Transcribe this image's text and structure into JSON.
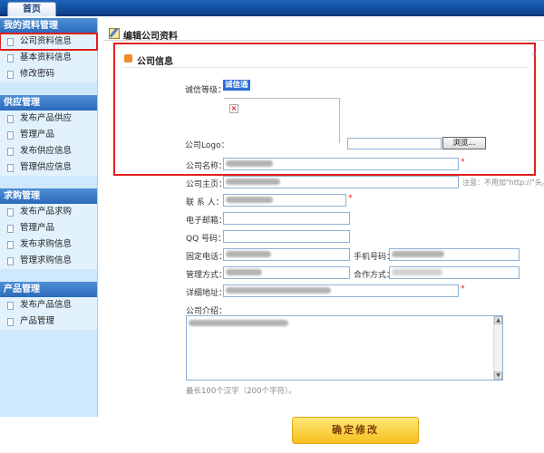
{
  "top_nav": {
    "home_tab": "首页"
  },
  "sidebar": {
    "groups": [
      {
        "title": "我的资料管理",
        "items": [
          "公司资料信息",
          "基本资料信息",
          "修改密码"
        ]
      },
      {
        "title": "供应管理",
        "items": [
          "发布产品供应",
          "管理产品",
          "发布供应信息",
          "管理供应信息"
        ]
      },
      {
        "title": "求购管理",
        "items": [
          "发布产品求购",
          "管理产品",
          "发布求购信息",
          "管理求购信息"
        ]
      },
      {
        "title": "产品管理",
        "items": [
          "发布产品信息",
          "产品管理"
        ]
      }
    ],
    "highlighted_item": "公司资料信息"
  },
  "page": {
    "title": "编辑公司资料",
    "section_title": "公司信息",
    "credit_level_label": "诚信等级：",
    "credit_level_value": "诚信通",
    "logo_label": "公司Logo：",
    "browse_button": "浏览...",
    "fields": {
      "company_name": {
        "label": "公司名称：",
        "value": ""
      },
      "homepage": {
        "label": "公司主页：",
        "value": "",
        "note": "注意：不用加\"http://\"头。"
      },
      "contact": {
        "label": "联 系 人：",
        "value": ""
      },
      "email": {
        "label": "电子邮箱：",
        "value": ""
      },
      "qq": {
        "label": "QQ 号码：",
        "value": ""
      },
      "phone": {
        "label": "固定电话：",
        "value": ""
      },
      "mobile": {
        "label": "手机号码：",
        "value": ""
      },
      "management": {
        "label": "管理方式：",
        "value": ""
      },
      "cooperation": {
        "label": "合作方式：",
        "value": ""
      },
      "address": {
        "label": "详细地址：",
        "value": ""
      },
      "intro": {
        "label": "公司介绍：",
        "value": ""
      }
    },
    "intro_hint": "最长100个汉字（200个字符）。",
    "required_mark": "*",
    "submit_button": "确定修改"
  },
  "colors": {
    "accent_blue": "#2a6bbb",
    "highlight_red": "#e0201c",
    "submit_yellow": "#f5c11e"
  },
  "icons": {
    "edit": "edit-document-icon",
    "section": "orange-square-icon",
    "broken_image": "broken-image-icon",
    "list_item": "document-icon"
  }
}
